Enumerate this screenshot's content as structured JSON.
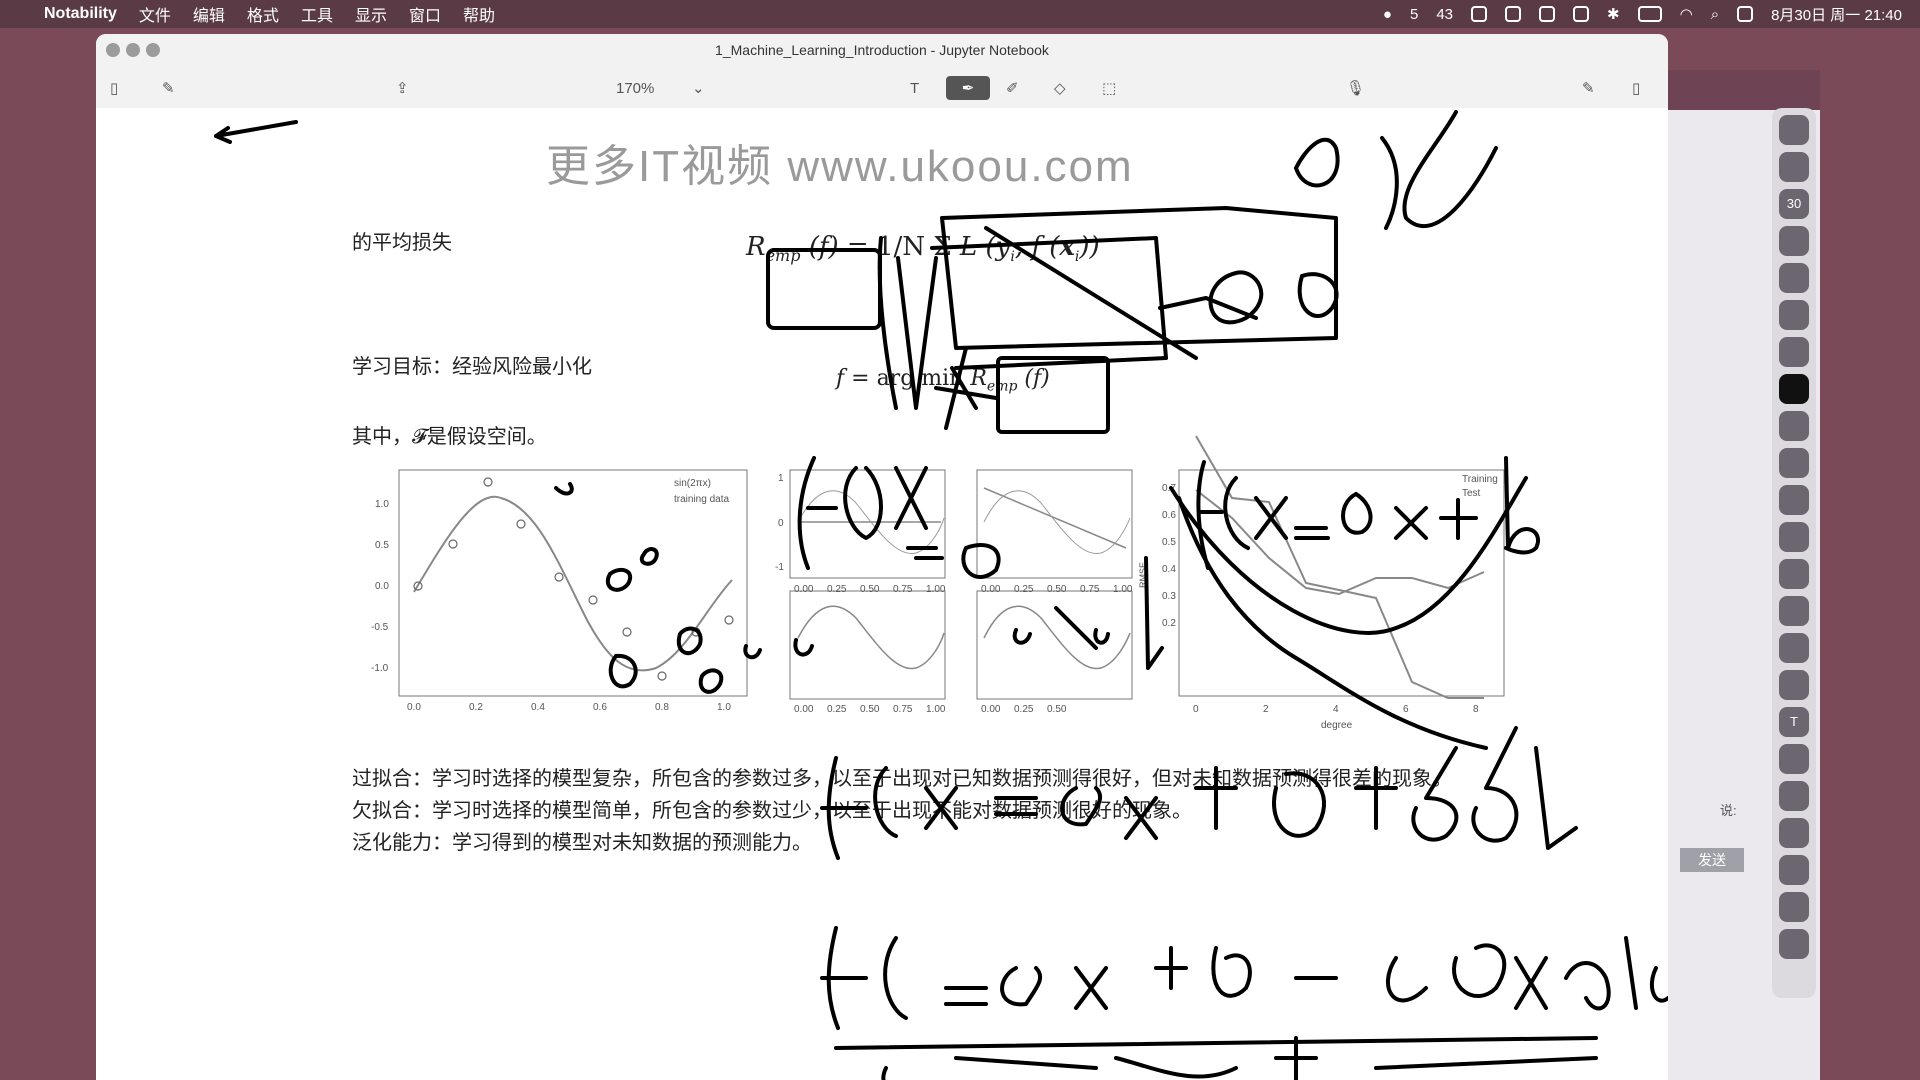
{
  "menubar": {
    "apple": "",
    "app": "Notability",
    "menus": [
      "文件",
      "编辑",
      "格式",
      "工具",
      "显示",
      "窗口",
      "帮助"
    ],
    "status": {
      "wechat_count": "5",
      "notif_count": "43",
      "datetime": "8月30日 周一 21:40"
    }
  },
  "window": {
    "title": "1_Machine_Learning_Introduction - Jupyter Notebook",
    "zoom": "170%",
    "tool_text": "T"
  },
  "watermark": "更多IT视频 www.ukoou.com",
  "content": {
    "line_avg_loss": "的平均损失",
    "formula_emp": "R_emp (f) = 1/N Σ_{i=1}^{N} L (y_i, f (x_i))",
    "formula_emp_lhs": "R",
    "formula_emp_sub": "emp",
    "line_goal": "学习目标：经验风险最小化",
    "formula_argmin": "f = arg min R_emp (f)",
    "line_space": "其中，𝓕是假设空间。",
    "overfit": "过拟合：学习时选择的模型复杂，所包含的参数过多，以至于出现对已知数据预测得很好，但对未知数据预测得很差的现象。",
    "underfit": "欠拟合：学习时选择的模型简单，所包含的参数过少，以至于出现不能对数据预测很好的现象。",
    "generalize": "泛化能力：学习得到的模型对未知数据的预测能力。"
  },
  "plots": {
    "sin_plot": {
      "legend": [
        "sin(2πx)",
        "training data"
      ],
      "yticks": [
        "1.0",
        "0.5",
        "0.0",
        "-0.5",
        "-1.0"
      ],
      "xticks": [
        "0.0",
        "0.2",
        "0.4",
        "0.6",
        "0.8",
        "1.0"
      ]
    },
    "small_plots": {
      "yticks": [
        "1",
        "0",
        "-1"
      ],
      "xticks": [
        "0.00",
        "0.25",
        "0.50",
        "0.75",
        "1.00"
      ]
    },
    "rmse_plot": {
      "legend": [
        "Training",
        "Test"
      ],
      "ylabel": "RMSE",
      "xlabel": "degree",
      "yticks": [
        "0.7",
        "0.6",
        "0.5",
        "0.4",
        "0.3",
        "0.2"
      ],
      "xticks": [
        "0",
        "2",
        "4",
        "6",
        "8"
      ]
    }
  },
  "background_app": {
    "send": "发送",
    "say": "说:"
  },
  "colors": {
    "menubar": "#5a3a44",
    "ink": "#000000",
    "watermark": "#9a9a9a"
  }
}
